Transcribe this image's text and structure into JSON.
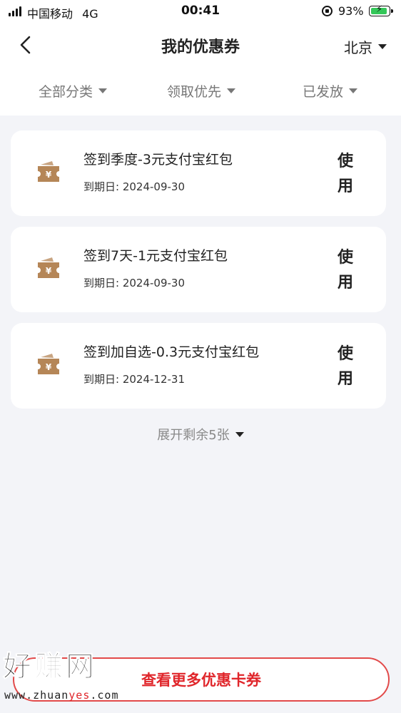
{
  "status_bar": {
    "carrier": "中国移动",
    "network": "4G",
    "time": "00:41",
    "battery_percent": "93%",
    "battery_level": 0.93,
    "charging": true
  },
  "nav": {
    "title": "我的优惠券",
    "city": "北京"
  },
  "filters": [
    {
      "label": "全部分类"
    },
    {
      "label": "领取优先"
    },
    {
      "label": "已发放"
    }
  ],
  "coupons": [
    {
      "title": "签到季度-3元支付宝红包",
      "expiry": "到期日: 2024-09-30",
      "action_top": "使",
      "action_bottom": "用"
    },
    {
      "title": "签到7天-1元支付宝红包",
      "expiry": "到期日: 2024-09-30",
      "action_top": "使",
      "action_bottom": "用"
    },
    {
      "title": "签到加自选-0.3元支付宝红包",
      "expiry": "到期日: 2024-12-31",
      "action_top": "使",
      "action_bottom": "用"
    }
  ],
  "expand_label": "展开剩余5张",
  "more_button_label": "查看更多优惠卡券",
  "watermark": {
    "brand": "好赚网",
    "url_prefix": "www.zhuan",
    "url_highlight": "yes",
    "url_suffix": ".com"
  },
  "colors": {
    "accent_red": "#e0262b",
    "ticket_brown": "#b58657",
    "background": "#f3f4f8"
  },
  "icons": {
    "back": "chevron-left-icon",
    "dropdown": "caret-down-icon",
    "coupon": "ticket-yuan-icon"
  }
}
